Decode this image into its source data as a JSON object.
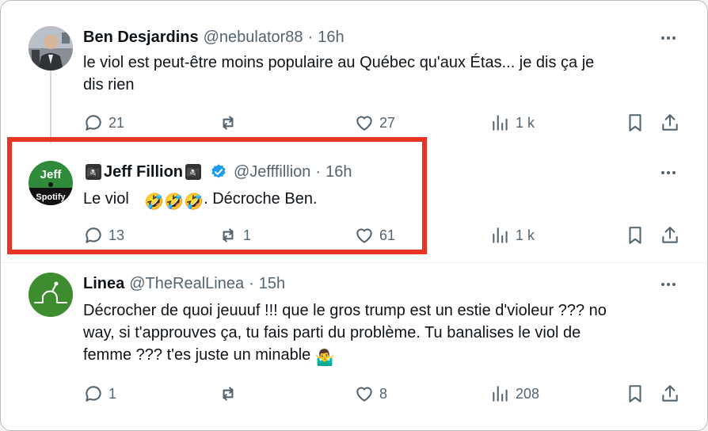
{
  "tweets": [
    {
      "name": "Ben Desjardins",
      "handle": "@nebulator88",
      "separator": "·",
      "time": "16h",
      "lines": [
        "le viol est peut-être moins populaire au Québec qu'aux Étas... je dis ça je",
        "dis rien"
      ],
      "replies": "21",
      "reposts": "",
      "likes": "27",
      "views": "1 k"
    },
    {
      "name": "Jeff Fillion",
      "name_prefix_emoji": "🏴‍☠️",
      "name_suffix_emoji": "🏴‍☠️",
      "handle": "@Jefffillion",
      "separator": "·",
      "time": "16h",
      "text_start": "Le viol",
      "text_emojis": "🤣🤣🤣",
      "text_end": ". Décroche Ben.",
      "avatar_text_top": "Jeff",
      "avatar_text_bottom": "Spotify",
      "replies": "13",
      "reposts": "1",
      "likes": "61",
      "views": "1 k",
      "verified": true
    },
    {
      "name": "Linea",
      "handle": "@TheRealLinea",
      "separator": "·",
      "time": "15h",
      "lines": [
        "Décrocher de quoi jeuuuf !!! que le gros trump est un estie d'violeur ??? no",
        "way, si t'approuves ça, tu fais parti du problème. Tu banalises le viol de",
        "femme ??? t'es juste un minable"
      ],
      "end_emoji": "🤷‍♂️",
      "replies": "1",
      "reposts": "",
      "likes": "8",
      "views": "208"
    }
  ],
  "colors": {
    "highlight_border": "#ea3323",
    "text_primary": "#0f1419",
    "text_secondary": "#536471",
    "verified_blue": "#1d9bf0",
    "thread_line": "#cfd9de"
  },
  "icons": [
    "reply-icon",
    "repost-icon",
    "like-icon",
    "views-icon",
    "bookmark-icon",
    "share-icon",
    "more-icon",
    "verified-icon"
  ]
}
